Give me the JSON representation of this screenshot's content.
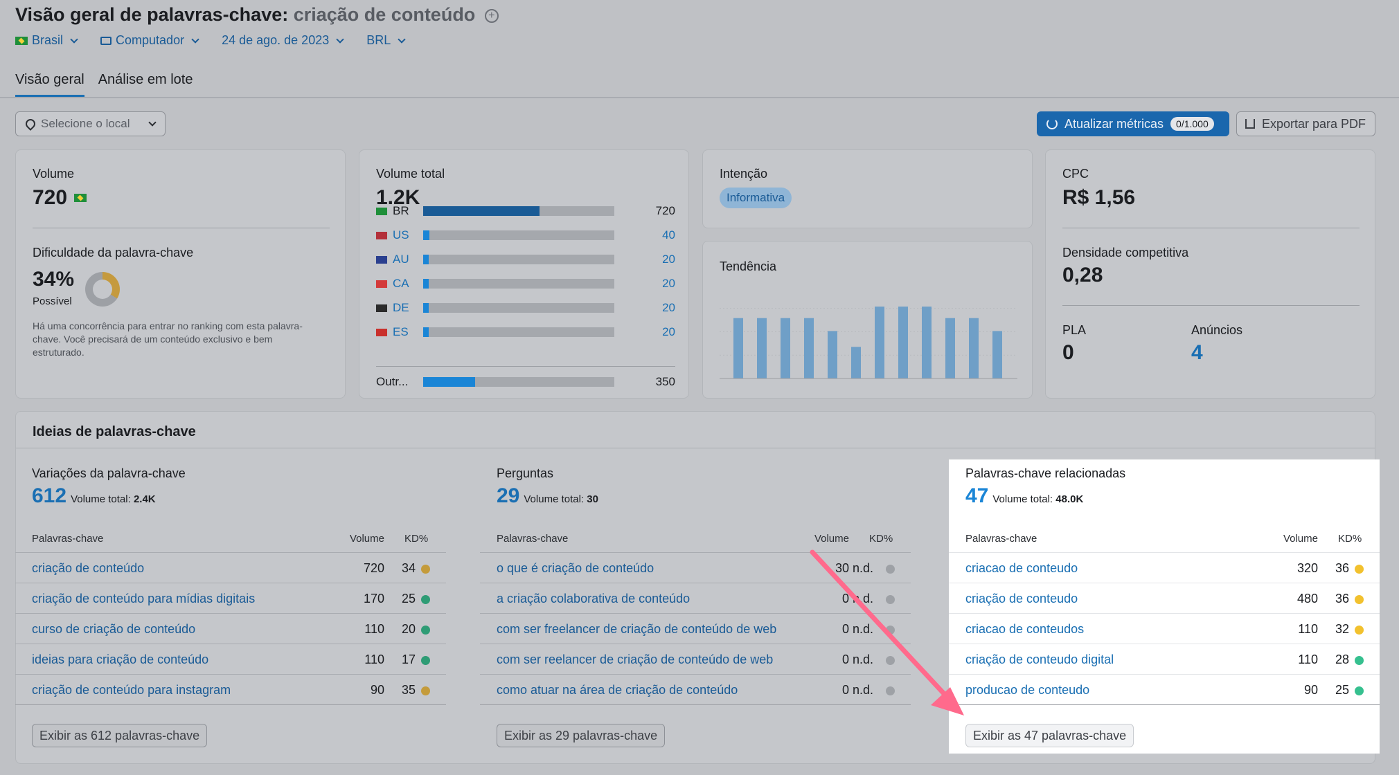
{
  "header": {
    "title_prefix": "Visão geral de palavras-chave:",
    "keyword": "criação de conteúdo",
    "filters": {
      "country": "Brasil",
      "device": "Computador",
      "date": "24 de ago. de 2023",
      "currency": "BRL"
    }
  },
  "tabs": [
    {
      "label": "Visão geral",
      "active": true
    },
    {
      "label": "Análise em lote",
      "active": false
    }
  ],
  "toolbar": {
    "location_placeholder": "Selecione o local",
    "update_label": "Atualizar métricas",
    "update_quota": "0/1.000",
    "export_label": "Exportar para PDF"
  },
  "volume_card": {
    "volume_label": "Volume",
    "volume_value": "720",
    "difficulty_label": "Dificuldade da palavra-chave",
    "difficulty_value": "34%",
    "difficulty_percent": 34,
    "difficulty_level": "Possível",
    "difficulty_text": "Há uma concorrência para entrar no ranking com esta palavra-chave. Você precisará de um conteúdo exclusivo e bem estruturado."
  },
  "total_volume_card": {
    "label": "Volume total",
    "value": "1.2K",
    "countries": [
      {
        "code": "BR",
        "value": "720",
        "share": 0.61,
        "highlight": false
      },
      {
        "code": "US",
        "value": "40",
        "share": 0.034,
        "highlight": true
      },
      {
        "code": "AU",
        "value": "20",
        "share": 0.017,
        "highlight": true
      },
      {
        "code": "CA",
        "value": "20",
        "share": 0.017,
        "highlight": true
      },
      {
        "code": "DE",
        "value": "20",
        "share": 0.017,
        "highlight": true
      },
      {
        "code": "ES",
        "value": "20",
        "share": 0.017,
        "highlight": true
      }
    ],
    "other_label": "Outr...",
    "other_value": "350",
    "other_share": 0.3
  },
  "intent_card": {
    "label": "Intenção",
    "tag": "Informativa"
  },
  "trend_card": {
    "label": "Tendência",
    "chart_data": {
      "type": "bar",
      "values": [
        0.84,
        0.84,
        0.84,
        0.84,
        0.66,
        0.44,
        1.0,
        1.0,
        1.0,
        0.84,
        0.84,
        0.66
      ]
    }
  },
  "cpc_card": {
    "cpc_label": "CPC",
    "cpc_value": "R$ 1,56",
    "density_label": "Densidade competitiva",
    "density_value": "0,28",
    "pla_label": "PLA",
    "pla_value": "0",
    "ads_label": "Anúncios",
    "ads_value": "4"
  },
  "ideas": {
    "title": "Ideias de palavras-chave",
    "columns": [
      {
        "heading": "Variações da palavra-chave",
        "count": "612",
        "total_label": "Volume total:",
        "total_value": "2.4K",
        "th_keyword": "Palavras-chave",
        "th_volume": "Volume",
        "th_kd": "KD%",
        "rows": [
          {
            "kw": "criação de conteúdo",
            "vol": "720",
            "kd": "34",
            "dot": "y"
          },
          {
            "kw": "criação de conteúdo para mídias digitais",
            "vol": "170",
            "kd": "25",
            "dot": "g"
          },
          {
            "kw": "curso de criação de conteúdo",
            "vol": "110",
            "kd": "20",
            "dot": "g"
          },
          {
            "kw": "ideias para criação de conteúdo",
            "vol": "110",
            "kd": "17",
            "dot": "g"
          },
          {
            "kw": "criação de conteúdo para instagram",
            "vol": "90",
            "kd": "35",
            "dot": "y"
          }
        ],
        "button": "Exibir as 612 palavras-chave"
      },
      {
        "heading": "Perguntas",
        "count": "29",
        "total_label": "Volume total:",
        "total_value": "30",
        "th_keyword": "Palavras-chave",
        "th_volume": "Volume",
        "th_kd": "KD%",
        "rows": [
          {
            "kw": "o que é criação de conteúdo",
            "vol": "30",
            "kd": "n.d.",
            "dot": "n"
          },
          {
            "kw": "a criação colaborativa de conteúdo",
            "vol": "0",
            "kd": "n.d.",
            "dot": "n"
          },
          {
            "kw": "com ser freelancer de criação de conteúdo de web",
            "vol": "0",
            "kd": "n.d.",
            "dot": "n"
          },
          {
            "kw": "com ser reelancer de criação de conteúdo de web",
            "vol": "0",
            "kd": "n.d.",
            "dot": "n"
          },
          {
            "kw": "como atuar na área de criação de conteúdo",
            "vol": "0",
            "kd": "n.d.",
            "dot": "n"
          }
        ],
        "button": "Exibir as 29 palavras-chave"
      },
      {
        "heading": "Palavras-chave relacionadas",
        "count": "47",
        "total_label": "Volume total:",
        "total_value": "48.0K",
        "th_keyword": "Palavras-chave",
        "th_volume": "Volume",
        "th_kd": "KD%",
        "rows": [
          {
            "kw": "criacao de conteudo",
            "vol": "320",
            "kd": "36",
            "dot": "y"
          },
          {
            "kw": "criação de conteudo",
            "vol": "480",
            "kd": "36",
            "dot": "y"
          },
          {
            "kw": "criacao de conteudos",
            "vol": "110",
            "kd": "32",
            "dot": "y"
          },
          {
            "kw": "criação de conteudo digital",
            "vol": "110",
            "kd": "28",
            "dot": "g"
          },
          {
            "kw": "producao de conteudo",
            "vol": "90",
            "kd": "25",
            "dot": "g"
          }
        ],
        "button": "Exibir as 47 palavras-chave"
      }
    ]
  },
  "colors": {
    "accent": "#1a6fb3",
    "arrow": "#ff6a8c",
    "bar": "#6f9fc7"
  }
}
